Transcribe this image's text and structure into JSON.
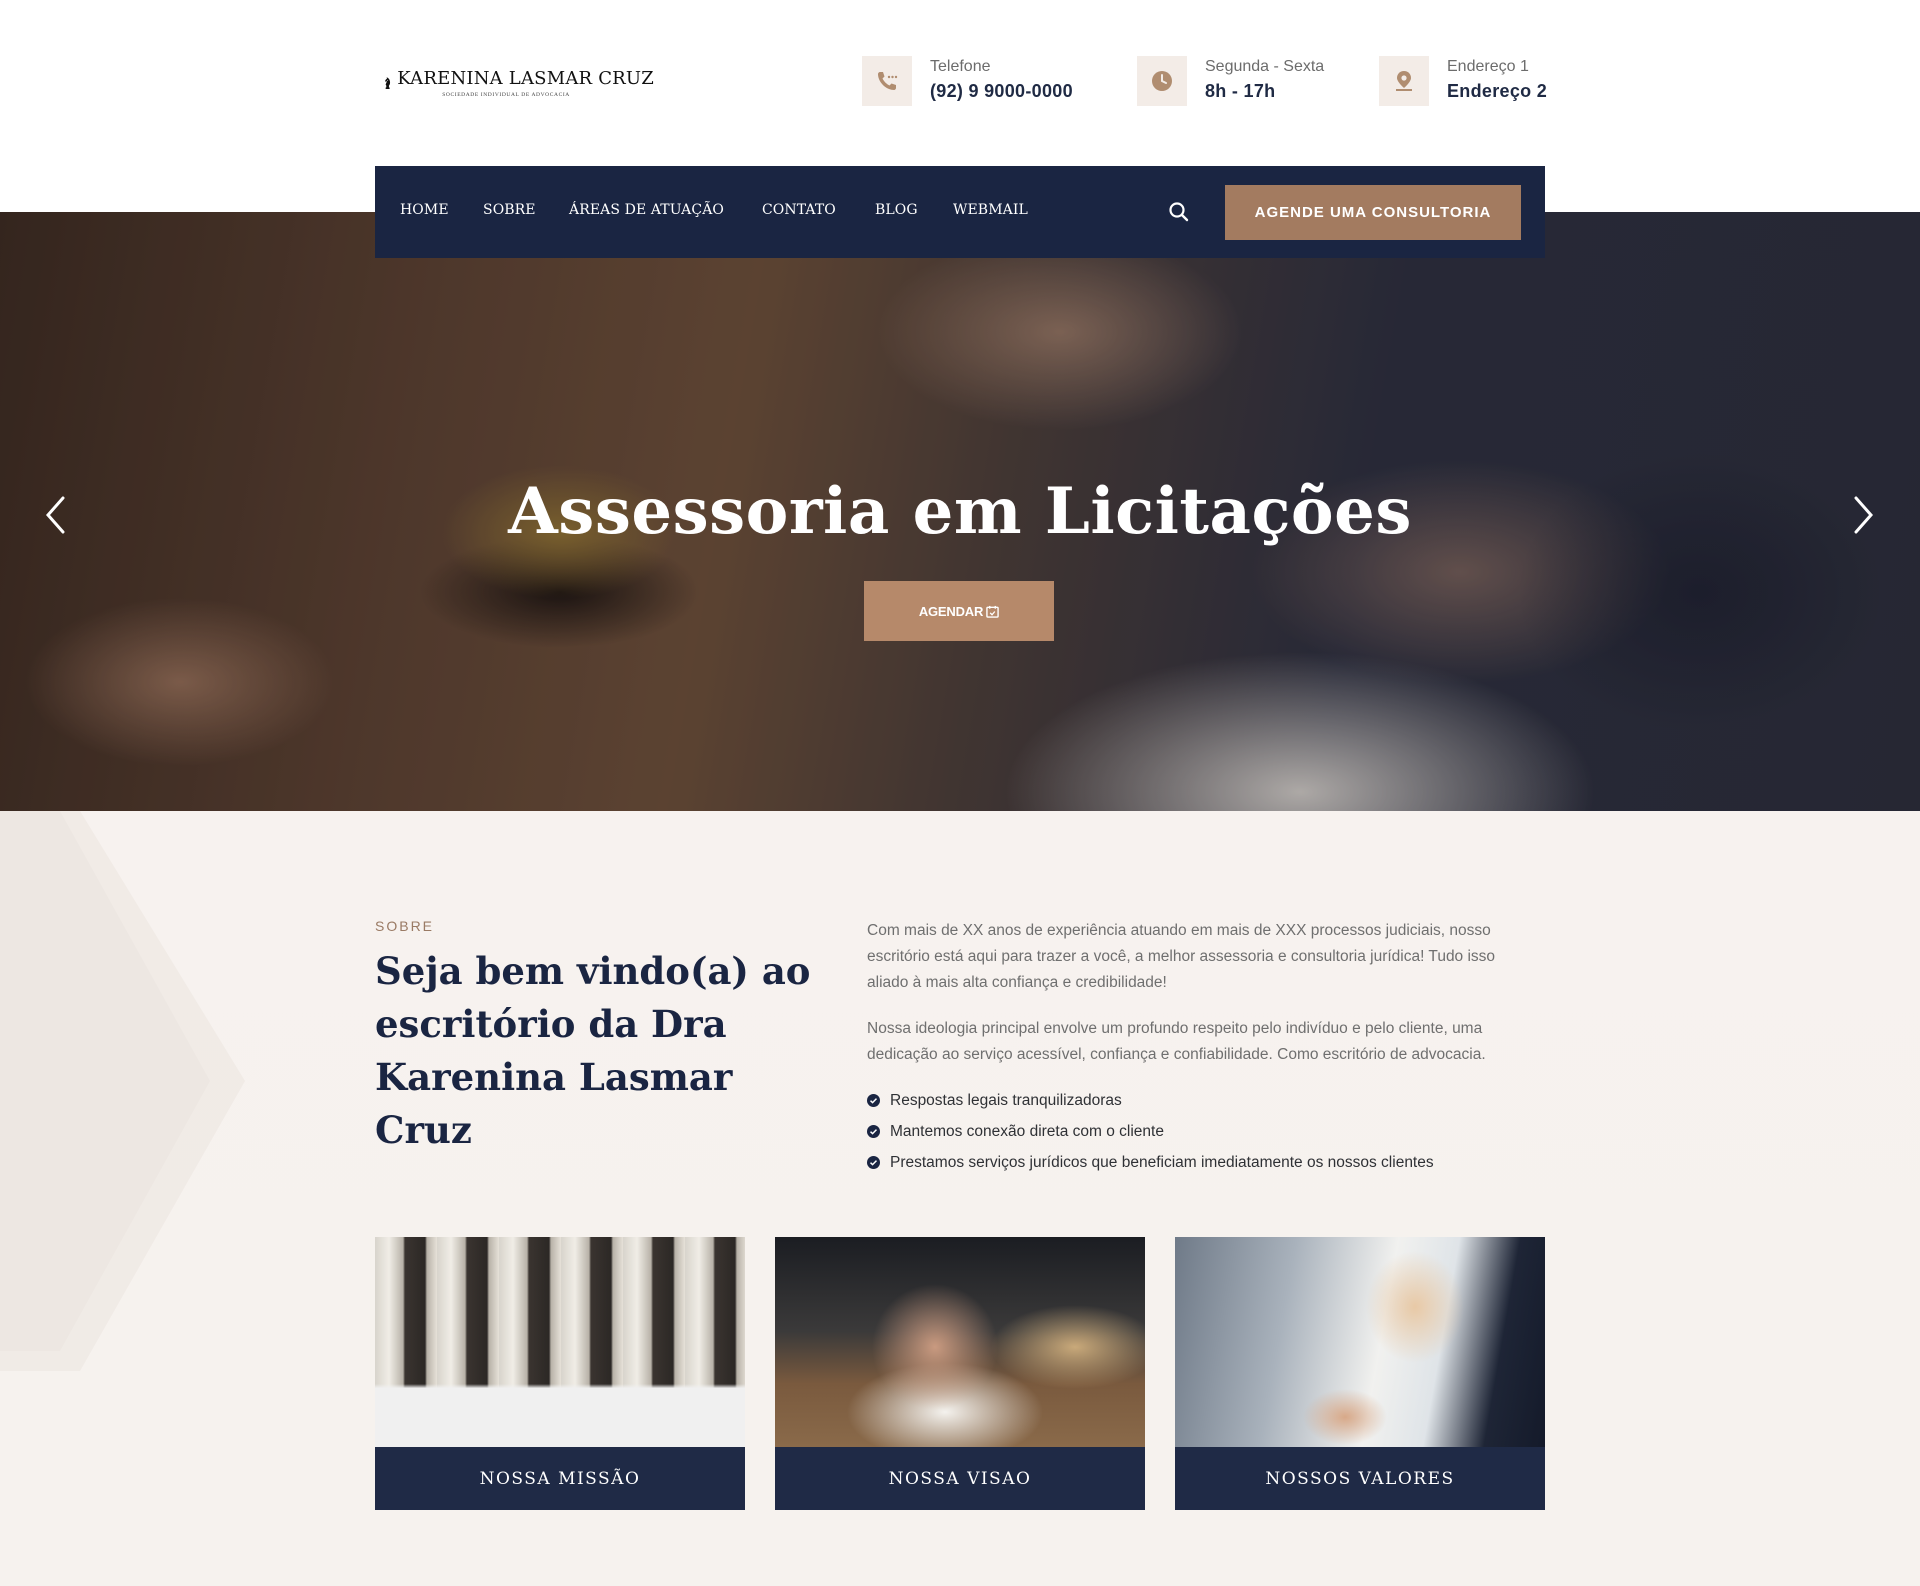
{
  "brand": {
    "name": "KARENINA LASMAR CRUZ",
    "tagline": "SOCIEDADE INDIVIDUAL DE ADVOCACIA"
  },
  "contact": {
    "phone": {
      "label": "Telefone",
      "value": "(92) 9 9000-0000",
      "icon": "phone-icon"
    },
    "hours": {
      "label": "Segunda - Sexta",
      "value": "8h - 17h",
      "icon": "clock-icon"
    },
    "address": {
      "label": "Endereço 1",
      "value": "Endereço 2",
      "icon": "location-icon"
    }
  },
  "nav": {
    "items": [
      "HOME",
      "SOBRE",
      "ÁREAS DE ATUAÇÃO",
      "CONTATO",
      "BLOG",
      "WEBMAIL"
    ],
    "cta": "AGENDE UMA CONSULTORIA"
  },
  "hero": {
    "title": "Assessoria em Licitações",
    "button": "AGENDAR"
  },
  "about": {
    "label": "SOBRE",
    "title": "Seja bem vindo(a) ao escritório da Dra Karenina Lasmar Cruz",
    "paragraph1": "Com mais de XX anos de experiência atuando em mais de XXX processos judiciais, nosso escritório está aqui para trazer a você, a melhor assessoria e consultoria jurídica! Tudo isso aliado à mais alta confiança e credibilidade!",
    "paragraph2": "Nossa ideologia principal envolve um profundo respeito pelo indivíduo e pelo cliente, uma dedicação ao serviço acessível, confiança e confiabilidade. Como escritório de advocacia.",
    "checklist": [
      "Respostas legais tranquilizadoras",
      "Mantemos conexão direta com o cliente",
      "Prestamos serviços jurídicos que beneficiam imediatamente os nossos clientes"
    ]
  },
  "cards": [
    {
      "title": "NOSSA MISSÃO"
    },
    {
      "title": "NOSSA VISAO"
    },
    {
      "title": "NOSSOS VALORES"
    }
  ],
  "colors": {
    "navy": "#1a2542",
    "bronze": "#a37b60",
    "hero_button": "#b6896a",
    "section_bg": "#f7f2ef"
  }
}
